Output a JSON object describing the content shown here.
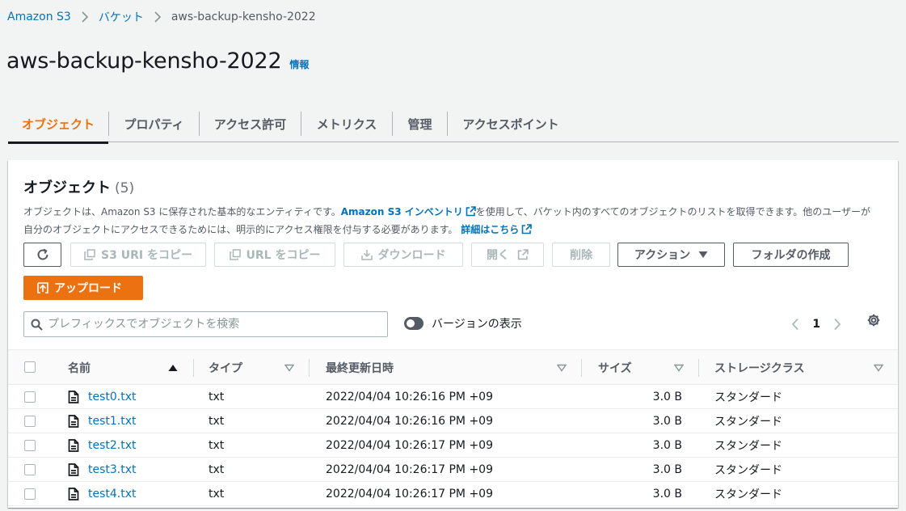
{
  "breadcrumb": {
    "items": [
      "Amazon S3",
      "バケット"
    ],
    "current": "aws-backup-kensho-2022"
  },
  "page": {
    "title": "aws-backup-kensho-2022",
    "info": "情報"
  },
  "tabs": [
    {
      "label": "オブジェクト",
      "active": true
    },
    {
      "label": "プロパティ"
    },
    {
      "label": "アクセス許可"
    },
    {
      "label": "メトリクス"
    },
    {
      "label": "管理"
    },
    {
      "label": "アクセスポイント"
    }
  ],
  "panel": {
    "title": "オブジェクト",
    "count": "(5)",
    "desc_1": "オブジェクトは、Amazon S3 に保存された基本的なエンティティです。",
    "desc_link": "Amazon S3 インベントリ",
    "desc_2": "を使用して、バケット内のすべてのオブジェクトのリストを取得できます。他のユーザーが自分のオブジェクトにアクセスできるためには、明示的にアクセス権限を付与する必要があります。",
    "desc_more": "詳細はこちら"
  },
  "toolbar": {
    "copy_s3_uri": "S3 URI をコピー",
    "copy_url": "URL をコピー",
    "download": "ダウンロード",
    "open": "開く",
    "delete": "削除",
    "actions": "アクション",
    "create_folder": "フォルダの作成",
    "upload": "アップロード"
  },
  "search": {
    "placeholder": "プレフィックスでオブジェクトを検索",
    "value": ""
  },
  "versions_toggle": {
    "label": "バージョンの表示",
    "on": false
  },
  "pagination": {
    "page": "1"
  },
  "table": {
    "columns": [
      "名前",
      "タイプ",
      "最終更新日時",
      "サイズ",
      "ストレージクラス"
    ],
    "rows": [
      {
        "name": "test0.txt",
        "type": "txt",
        "modified": "2022/04/04 10:26:16 PM +09",
        "size": "3.0 B",
        "storage": "スタンダード"
      },
      {
        "name": "test1.txt",
        "type": "txt",
        "modified": "2022/04/04 10:26:16 PM +09",
        "size": "3.0 B",
        "storage": "スタンダード"
      },
      {
        "name": "test2.txt",
        "type": "txt",
        "modified": "2022/04/04 10:26:17 PM +09",
        "size": "3.0 B",
        "storage": "スタンダード"
      },
      {
        "name": "test3.txt",
        "type": "txt",
        "modified": "2022/04/04 10:26:17 PM +09",
        "size": "3.0 B",
        "storage": "スタンダード"
      },
      {
        "name": "test4.txt",
        "type": "txt",
        "modified": "2022/04/04 10:26:17 PM +09",
        "size": "3.0 B",
        "storage": "スタンダード"
      }
    ]
  },
  "colors": {
    "accent": "#ec7211",
    "link": "#0073bb",
    "text": "#16191f",
    "muted": "#545b64"
  }
}
